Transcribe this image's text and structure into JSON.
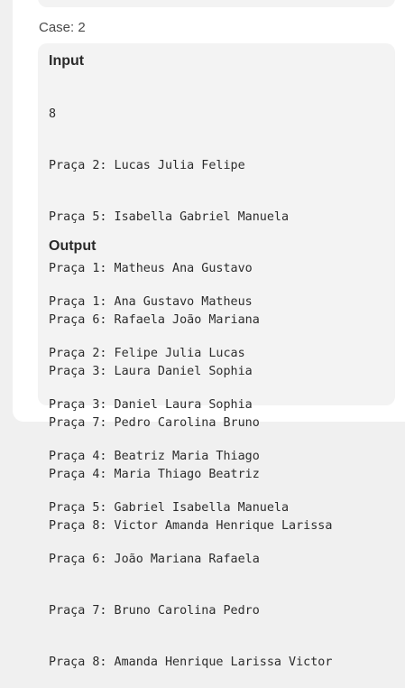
{
  "case": {
    "label": "Case: 2"
  },
  "input": {
    "title": "Input",
    "lines": [
      "8",
      "Praça 2: Lucas Julia Felipe",
      "Praça 5: Isabella Gabriel Manuela",
      "Praça 1: Matheus Ana Gustavo",
      "Praça 6: Rafaela João Mariana",
      "Praça 3: Laura Daniel Sophia",
      "Praça 7: Pedro Carolina Bruno",
      "Praça 4: Maria Thiago Beatriz",
      "Praça 8: Victor Amanda Henrique Larissa"
    ]
  },
  "output": {
    "title": "Output",
    "lines": [
      "Praça 1: Ana Gustavo Matheus",
      "Praça 2: Felipe Julia Lucas",
      "Praça 3: Daniel Laura Sophia",
      "Praça 4: Beatriz Maria Thiago",
      "Praça 5: Gabriel Isabella Manuela",
      "Praça 6: João Mariana Rafaela",
      "Praça 7: Bruno Carolina Pedro",
      "Praça 8: Amanda Henrique Larissa Victor"
    ]
  }
}
